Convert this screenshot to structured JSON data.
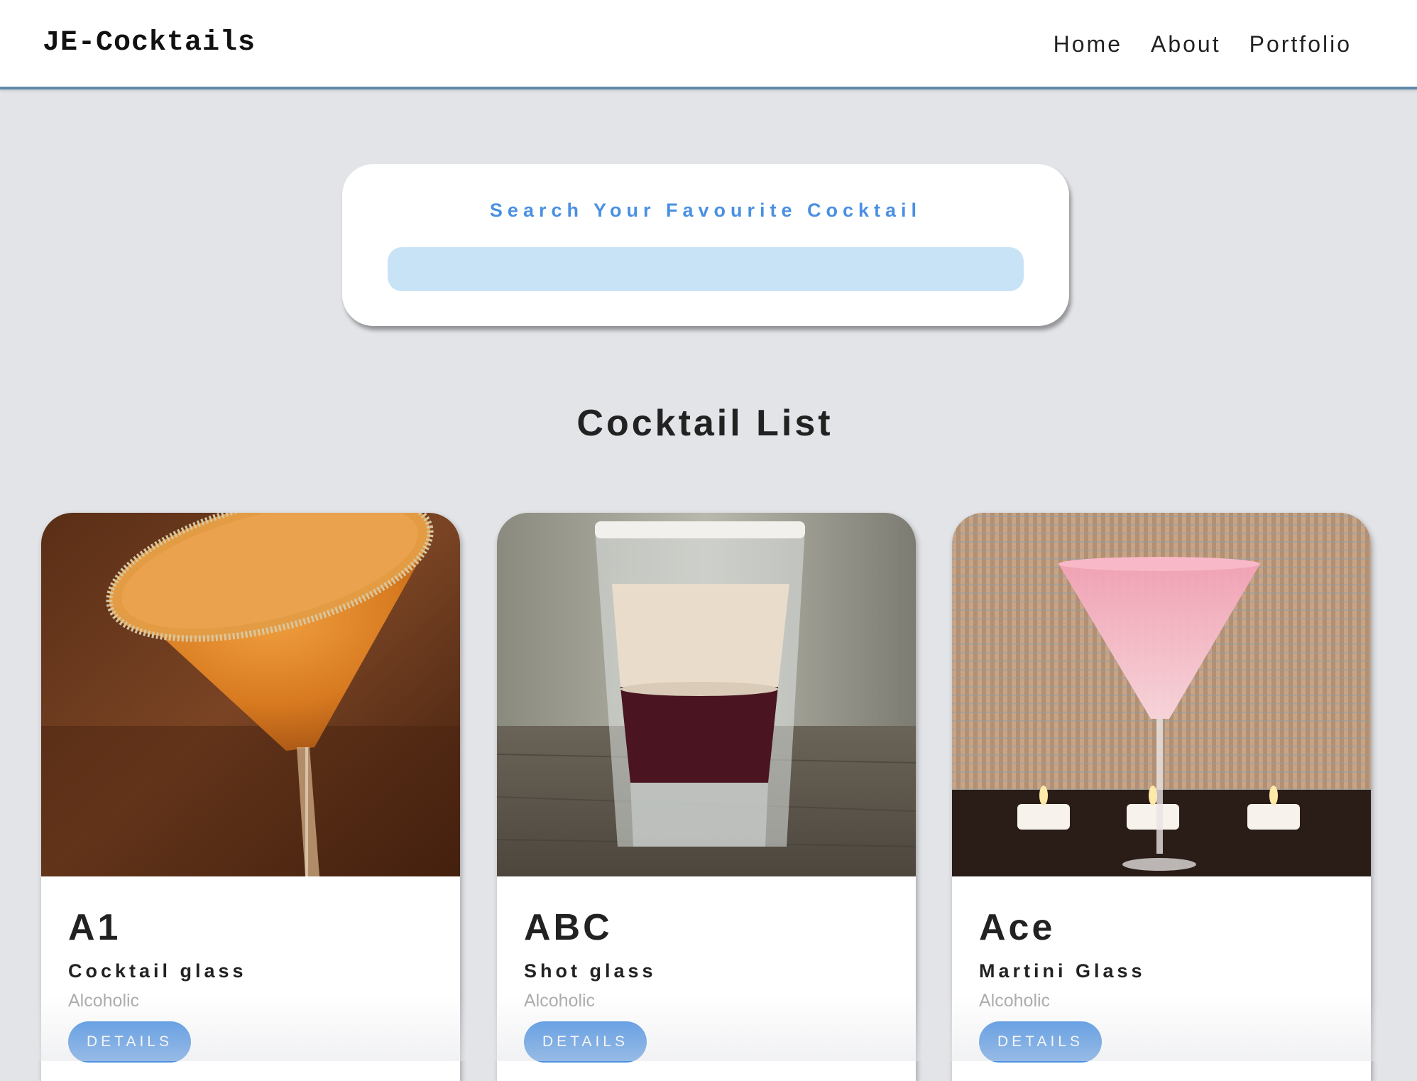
{
  "navbar": {
    "brand": "JE-Cocktails",
    "links": [
      {
        "label": "Home"
      },
      {
        "label": "About"
      },
      {
        "label": "Portfolio"
      }
    ]
  },
  "search": {
    "label": "Search Your Favourite Cocktail",
    "value": "",
    "placeholder": ""
  },
  "section": {
    "title": "Cocktail List"
  },
  "cocktails": [
    {
      "name": "A1",
      "glass": "Cocktail glass",
      "type": "Alcoholic",
      "button": "DETAILS",
      "image_icon": "orange-martini-photo"
    },
    {
      "name": "ABC",
      "glass": "Shot glass",
      "type": "Alcoholic",
      "button": "DETAILS",
      "image_icon": "layered-shot-photo"
    },
    {
      "name": "Ace",
      "glass": "Martini Glass",
      "type": "Alcoholic",
      "button": "DETAILS",
      "image_icon": "pink-martini-photo"
    }
  ],
  "colors": {
    "accent": "#4a90e2",
    "search_input_bg": "#c9e3f6",
    "page_bg": "#e3e4e8",
    "navbar_border": "#5f8aa6"
  }
}
